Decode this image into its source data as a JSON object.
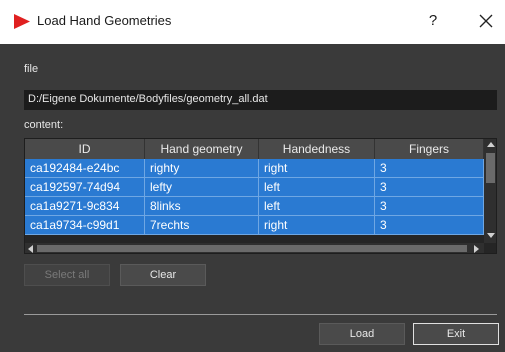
{
  "window": {
    "title": "Load Hand Geometries",
    "help_label": "?",
    "accent_color": "#e02020"
  },
  "file_section": {
    "label": "file",
    "path": "D:/Eigene Dokumente/Bodyfiles/geometry_all.dat"
  },
  "content_section": {
    "label": "content:",
    "columns": [
      "ID",
      "Hand geometry",
      "Handedness",
      "Fingers"
    ],
    "rows": [
      [
        "ca192484-e24bc",
        "righty",
        "right",
        "3"
      ],
      [
        "ca192597-74d94",
        "lefty",
        "left",
        "3"
      ],
      [
        "ca1a9271-9c834",
        "8links",
        "left",
        "3"
      ],
      [
        "ca1a9734-c99d1",
        "7rechts",
        "right",
        "3"
      ]
    ],
    "selection_color": "#2a7ad2"
  },
  "buttons": {
    "select_all": "Select all",
    "clear": "Clear",
    "load": "Load",
    "exit": "Exit"
  }
}
